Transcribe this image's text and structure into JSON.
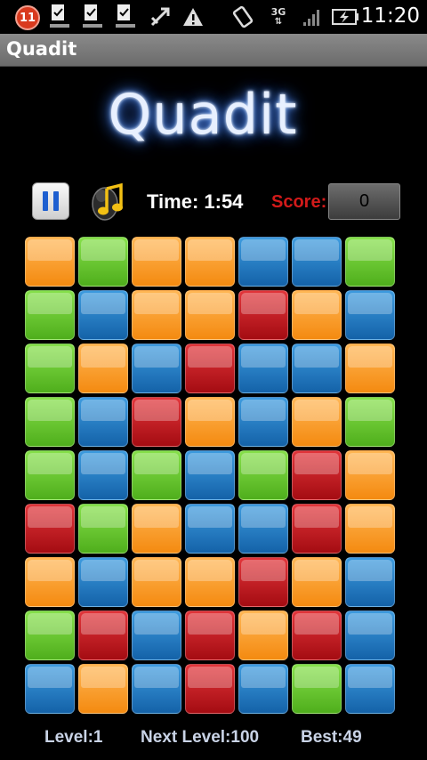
{
  "status_bar": {
    "notification_count": "11",
    "time": "11:20",
    "network_label": "3G",
    "icons": [
      "notification-badge",
      "download-complete-icon",
      "download-complete-icon",
      "download-complete-icon",
      "usb-debug-icon",
      "warning-icon",
      "rotate-icon",
      "network-3g-icon",
      "signal-bars-icon",
      "battery-charging-icon"
    ]
  },
  "app": {
    "title": "Quadit",
    "logo_text": "Quadit"
  },
  "controls": {
    "pause_icon": "pause-icon",
    "music_icon": "music-note-icon",
    "time_text": "Time: 1:54",
    "score_label": "Score:",
    "score_value": "0"
  },
  "colors": {
    "orange": "#f7a12e",
    "green": "#6ccb33",
    "blue": "#2a7fc6",
    "red": "#c61e24",
    "score_label": "#d21a1a"
  },
  "board": {
    "rows": 9,
    "cols": 7,
    "tiles": [
      [
        "orange",
        "green",
        "orange",
        "orange",
        "blue",
        "blue",
        "green"
      ],
      [
        "green",
        "blue",
        "orange",
        "orange",
        "red",
        "orange",
        "blue"
      ],
      [
        "green",
        "orange",
        "blue",
        "red",
        "blue",
        "blue",
        "orange"
      ],
      [
        "green",
        "blue",
        "red",
        "orange",
        "blue",
        "orange",
        "green"
      ],
      [
        "green",
        "blue",
        "green",
        "blue",
        "green",
        "red",
        "orange"
      ],
      [
        "red",
        "green",
        "orange",
        "blue",
        "blue",
        "red",
        "orange"
      ],
      [
        "orange",
        "blue",
        "orange",
        "orange",
        "red",
        "orange",
        "blue"
      ],
      [
        "green",
        "red",
        "blue",
        "red",
        "orange",
        "red",
        "blue"
      ],
      [
        "blue",
        "orange",
        "blue",
        "red",
        "blue",
        "green",
        "blue"
      ]
    ]
  },
  "footer": {
    "level": "Level:1",
    "next_level": "Next Level:100",
    "best": "Best:49"
  }
}
